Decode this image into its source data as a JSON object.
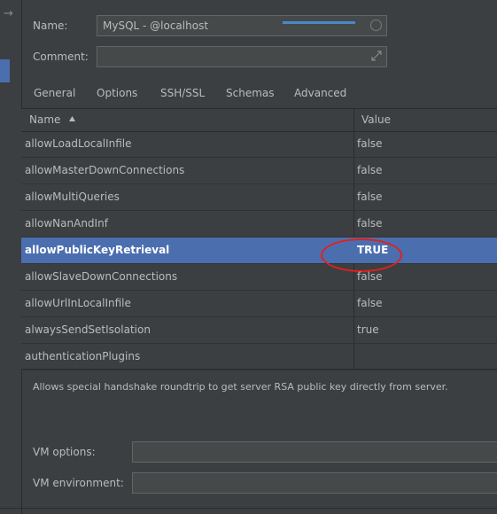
{
  "form": {
    "name_label": "Name:",
    "name_value": "MySQL - @localhost",
    "comment_label": "Comment:",
    "comment_value": ""
  },
  "tabs": [
    {
      "label": "General"
    },
    {
      "label": "Options"
    },
    {
      "label": "SSH/SSL"
    },
    {
      "label": "Schemas"
    },
    {
      "label": "Advanced",
      "active": true
    }
  ],
  "table": {
    "header_name": "Name",
    "header_value": "Value",
    "sort_icon": "sort-ascending-icon",
    "rows": [
      {
        "name": "allowLoadLocalInfile",
        "value": "false"
      },
      {
        "name": "allowMasterDownConnections",
        "value": "false"
      },
      {
        "name": "allowMultiQueries",
        "value": "false"
      },
      {
        "name": "allowNanAndInf",
        "value": "false"
      },
      {
        "name": "allowPublicKeyRetrieval",
        "value": "TRUE",
        "selected": true
      },
      {
        "name": "allowSlaveDownConnections",
        "value": "false"
      },
      {
        "name": "allowUrlInLocalInfile",
        "value": "false"
      },
      {
        "name": "alwaysSendSetIsolation",
        "value": "true"
      },
      {
        "name": "authenticationPlugins",
        "value": ""
      }
    ]
  },
  "description": "Allows special handshake roundtrip to get server RSA public key directly from server.",
  "vm": {
    "options_label": "VM options:",
    "options_value": "",
    "environment_label": "VM environment:",
    "environment_value": ""
  },
  "colors": {
    "background": "#3c3f41",
    "selection": "#4b6eaf",
    "tab_underline": "#4a88c7",
    "annotation": "#e02020"
  }
}
